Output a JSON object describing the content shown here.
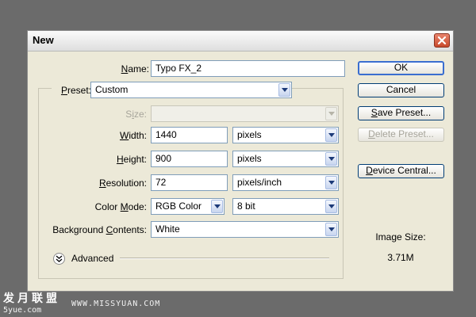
{
  "window": {
    "title": "New"
  },
  "fields": {
    "name": {
      "label_mn": "N",
      "label_rest": "ame:",
      "value": "Typo FX_2"
    },
    "preset": {
      "label_mn": "P",
      "label_rest": "reset:",
      "value": "Custom"
    },
    "size": {
      "label_pre": "S",
      "label_mn": "i",
      "label_rest": "ze:",
      "value": ""
    },
    "width": {
      "label_mn": "W",
      "label_rest": "idth:",
      "value": "1440",
      "unit": "pixels"
    },
    "height": {
      "label_mn": "H",
      "label_rest": "eight:",
      "value": "900",
      "unit": "pixels"
    },
    "resolution": {
      "label_mn": "R",
      "label_rest": "esolution:",
      "value": "72",
      "unit": "pixels/inch"
    },
    "color_mode": {
      "label_pre": "Color ",
      "label_mn": "M",
      "label_rest": "ode:",
      "value": "RGB Color",
      "depth": "8 bit"
    },
    "background": {
      "label_pre": "Background ",
      "label_mn": "C",
      "label_rest": "ontents:",
      "value": "White"
    }
  },
  "advanced": {
    "label": "Advanced"
  },
  "buttons": {
    "ok": "OK",
    "cancel": "Cancel",
    "save_preset_mn": "S",
    "save_preset_rest": "ave Preset...",
    "delete_preset_mn": "D",
    "delete_preset_rest": "elete Preset...",
    "device_central_mn": "D",
    "device_central_rest": "evice Central..."
  },
  "image_size": {
    "label": "Image Size:",
    "value": "3.71M"
  },
  "watermark": {
    "chinese": "发月联盟",
    "url": "WWW.MISSYUAN.COM",
    "url2": "5yue.com"
  },
  "colors": {
    "dialog_bg": "#ece9d8",
    "screen_bg": "#6b6b6b",
    "close_red": "#c8492c",
    "button_border": "#003c74"
  }
}
